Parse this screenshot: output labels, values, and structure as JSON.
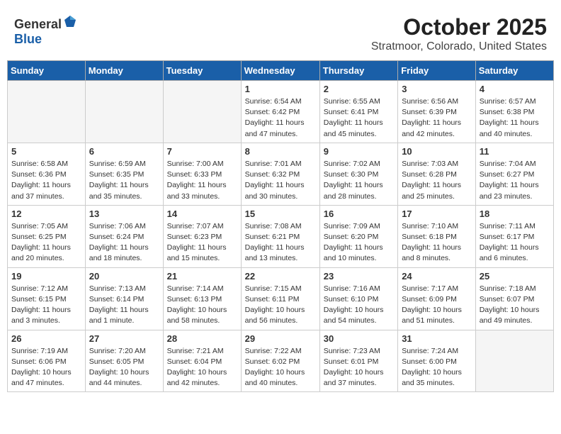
{
  "header": {
    "logo_general": "General",
    "logo_blue": "Blue",
    "month": "October 2025",
    "location": "Stratmoor, Colorado, United States"
  },
  "weekdays": [
    "Sunday",
    "Monday",
    "Tuesday",
    "Wednesday",
    "Thursday",
    "Friday",
    "Saturday"
  ],
  "weeks": [
    [
      {
        "day": "",
        "info": ""
      },
      {
        "day": "",
        "info": ""
      },
      {
        "day": "",
        "info": ""
      },
      {
        "day": "1",
        "info": "Sunrise: 6:54 AM\nSunset: 6:42 PM\nDaylight: 11 hours\nand 47 minutes."
      },
      {
        "day": "2",
        "info": "Sunrise: 6:55 AM\nSunset: 6:41 PM\nDaylight: 11 hours\nand 45 minutes."
      },
      {
        "day": "3",
        "info": "Sunrise: 6:56 AM\nSunset: 6:39 PM\nDaylight: 11 hours\nand 42 minutes."
      },
      {
        "day": "4",
        "info": "Sunrise: 6:57 AM\nSunset: 6:38 PM\nDaylight: 11 hours\nand 40 minutes."
      }
    ],
    [
      {
        "day": "5",
        "info": "Sunrise: 6:58 AM\nSunset: 6:36 PM\nDaylight: 11 hours\nand 37 minutes."
      },
      {
        "day": "6",
        "info": "Sunrise: 6:59 AM\nSunset: 6:35 PM\nDaylight: 11 hours\nand 35 minutes."
      },
      {
        "day": "7",
        "info": "Sunrise: 7:00 AM\nSunset: 6:33 PM\nDaylight: 11 hours\nand 33 minutes."
      },
      {
        "day": "8",
        "info": "Sunrise: 7:01 AM\nSunset: 6:32 PM\nDaylight: 11 hours\nand 30 minutes."
      },
      {
        "day": "9",
        "info": "Sunrise: 7:02 AM\nSunset: 6:30 PM\nDaylight: 11 hours\nand 28 minutes."
      },
      {
        "day": "10",
        "info": "Sunrise: 7:03 AM\nSunset: 6:28 PM\nDaylight: 11 hours\nand 25 minutes."
      },
      {
        "day": "11",
        "info": "Sunrise: 7:04 AM\nSunset: 6:27 PM\nDaylight: 11 hours\nand 23 minutes."
      }
    ],
    [
      {
        "day": "12",
        "info": "Sunrise: 7:05 AM\nSunset: 6:25 PM\nDaylight: 11 hours\nand 20 minutes."
      },
      {
        "day": "13",
        "info": "Sunrise: 7:06 AM\nSunset: 6:24 PM\nDaylight: 11 hours\nand 18 minutes."
      },
      {
        "day": "14",
        "info": "Sunrise: 7:07 AM\nSunset: 6:23 PM\nDaylight: 11 hours\nand 15 minutes."
      },
      {
        "day": "15",
        "info": "Sunrise: 7:08 AM\nSunset: 6:21 PM\nDaylight: 11 hours\nand 13 minutes."
      },
      {
        "day": "16",
        "info": "Sunrise: 7:09 AM\nSunset: 6:20 PM\nDaylight: 11 hours\nand 10 minutes."
      },
      {
        "day": "17",
        "info": "Sunrise: 7:10 AM\nSunset: 6:18 PM\nDaylight: 11 hours\nand 8 minutes."
      },
      {
        "day": "18",
        "info": "Sunrise: 7:11 AM\nSunset: 6:17 PM\nDaylight: 11 hours\nand 6 minutes."
      }
    ],
    [
      {
        "day": "19",
        "info": "Sunrise: 7:12 AM\nSunset: 6:15 PM\nDaylight: 11 hours\nand 3 minutes."
      },
      {
        "day": "20",
        "info": "Sunrise: 7:13 AM\nSunset: 6:14 PM\nDaylight: 11 hours\nand 1 minute."
      },
      {
        "day": "21",
        "info": "Sunrise: 7:14 AM\nSunset: 6:13 PM\nDaylight: 10 hours\nand 58 minutes."
      },
      {
        "day": "22",
        "info": "Sunrise: 7:15 AM\nSunset: 6:11 PM\nDaylight: 10 hours\nand 56 minutes."
      },
      {
        "day": "23",
        "info": "Sunrise: 7:16 AM\nSunset: 6:10 PM\nDaylight: 10 hours\nand 54 minutes."
      },
      {
        "day": "24",
        "info": "Sunrise: 7:17 AM\nSunset: 6:09 PM\nDaylight: 10 hours\nand 51 minutes."
      },
      {
        "day": "25",
        "info": "Sunrise: 7:18 AM\nSunset: 6:07 PM\nDaylight: 10 hours\nand 49 minutes."
      }
    ],
    [
      {
        "day": "26",
        "info": "Sunrise: 7:19 AM\nSunset: 6:06 PM\nDaylight: 10 hours\nand 47 minutes."
      },
      {
        "day": "27",
        "info": "Sunrise: 7:20 AM\nSunset: 6:05 PM\nDaylight: 10 hours\nand 44 minutes."
      },
      {
        "day": "28",
        "info": "Sunrise: 7:21 AM\nSunset: 6:04 PM\nDaylight: 10 hours\nand 42 minutes."
      },
      {
        "day": "29",
        "info": "Sunrise: 7:22 AM\nSunset: 6:02 PM\nDaylight: 10 hours\nand 40 minutes."
      },
      {
        "day": "30",
        "info": "Sunrise: 7:23 AM\nSunset: 6:01 PM\nDaylight: 10 hours\nand 37 minutes."
      },
      {
        "day": "31",
        "info": "Sunrise: 7:24 AM\nSunset: 6:00 PM\nDaylight: 10 hours\nand 35 minutes."
      },
      {
        "day": "",
        "info": ""
      }
    ]
  ]
}
